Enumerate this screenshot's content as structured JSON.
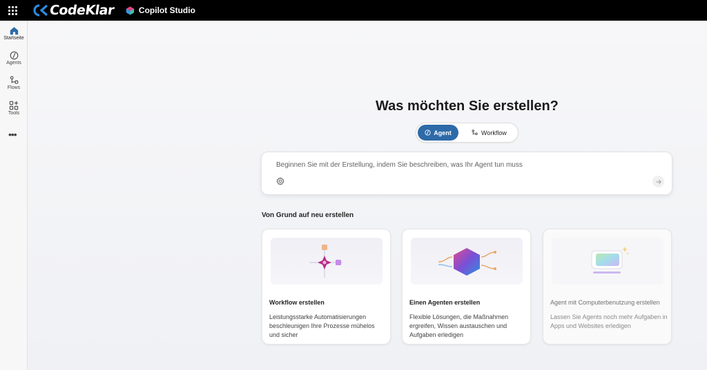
{
  "topbar": {
    "brand": "CodeKlar",
    "product": "Copilot Studio"
  },
  "rail": {
    "items": [
      {
        "label": "Startseite",
        "icon": "home-icon",
        "active": true
      },
      {
        "label": "Agents",
        "icon": "agent-icon"
      },
      {
        "label": "Flows",
        "icon": "flow-icon"
      },
      {
        "label": "Tools",
        "icon": "tools-icon"
      }
    ],
    "more": "•••"
  },
  "main": {
    "heading": "Was möchten Sie erstellen?",
    "toggle": {
      "agent": "Agent",
      "workflow": "Workflow",
      "selected": "Agent"
    },
    "prompt": {
      "placeholder": "Beginnen Sie mit der Erstellung, indem Sie beschreiben, was Ihr Agent tun muss"
    },
    "section_title": "Von Grund auf neu erstellen",
    "cards": [
      {
        "title": "Workflow erstellen",
        "description": "Leistungsstarke Automatisierungen beschleunigen Ihre Prozesse mühelos und sicher"
      },
      {
        "title": "Einen Agenten erstellen",
        "description": "Flexible Lösungen, die Maßnahmen ergreifen, Wissen austauschen und Aufgaben erledigen"
      },
      {
        "title": "Agent mit Computerbenutzung erstellen",
        "description": "Lassen Sie Agents noch mehr Aufgaben in Apps und Websites erledigen"
      }
    ]
  },
  "colors": {
    "accent": "#2d6aa8",
    "topbar": "#000000"
  }
}
